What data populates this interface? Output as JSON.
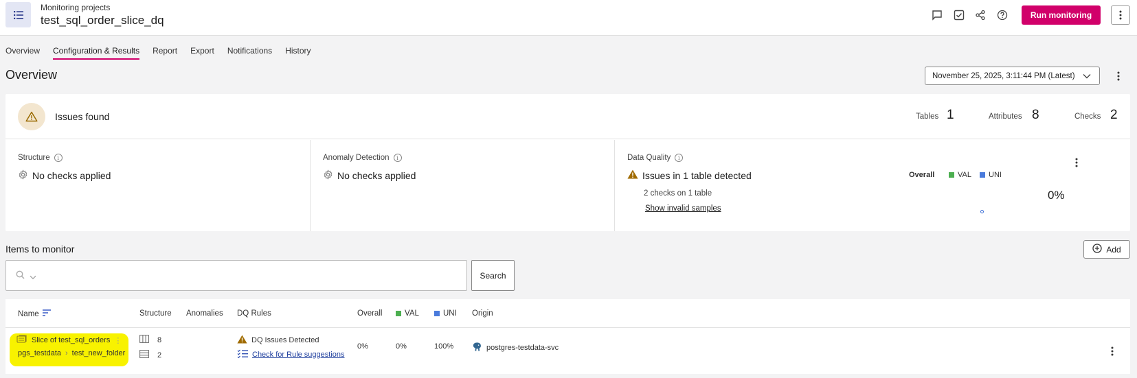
{
  "header": {
    "breadcrumb": "Monitoring projects",
    "title": "test_sql_order_slice_dq",
    "run_label": "Run monitoring",
    "icons": [
      "comment-icon",
      "task-check-icon",
      "share-icon",
      "help-icon",
      "more-vert-icon"
    ]
  },
  "tabs": [
    {
      "label": "Overview",
      "active": false
    },
    {
      "label": "Configuration & Results",
      "active": true
    },
    {
      "label": "Report",
      "active": false
    },
    {
      "label": "Export",
      "active": false
    },
    {
      "label": "Notifications",
      "active": false
    },
    {
      "label": "History",
      "active": false
    }
  ],
  "page": {
    "title": "Overview",
    "date_selected": "November 25, 2025, 3:11:44 PM (Latest)"
  },
  "summary": {
    "title": "Issues found",
    "tables_label": "Tables",
    "tables_value": "1",
    "attributes_label": "Attributes",
    "attributes_value": "8",
    "checks_label": "Checks",
    "checks_value": "2"
  },
  "panels": {
    "structure": {
      "label": "Structure",
      "status": "No checks applied"
    },
    "anomaly": {
      "label": "Anomaly Detection",
      "status": "No checks applied"
    },
    "dq": {
      "label": "Data Quality",
      "status": "Issues in 1 table detected",
      "sub": "2 checks on 1 table",
      "link": "Show invalid samples",
      "legend_overall": "Overall",
      "legend_val": "VAL",
      "legend_uni": "UNI",
      "overall_pct": "0%"
    }
  },
  "items": {
    "title": "Items to monitor",
    "add_label": "Add",
    "search_label": "Search",
    "search_value": ""
  },
  "table": {
    "headers": {
      "name": "Name",
      "structure": "Structure",
      "anomalies": "Anomalies",
      "dq_rules": "DQ Rules",
      "overall": "Overall",
      "val": "VAL",
      "uni": "UNI",
      "origin": "Origin"
    },
    "rows": [
      {
        "name": "Slice of test_sql_orders",
        "path_db": "pgs_testdata",
        "path_folder": "test_new_folder",
        "structure_attrs": "8",
        "structure_tables": "2",
        "dq_status": "DQ Issues Detected",
        "dq_link": "Check for Rule suggestions",
        "overall": "0%",
        "val": "0%",
        "uni": "100%",
        "origin": "postgres-testdata-svc"
      }
    ]
  },
  "colors": {
    "accent": "#d1006a",
    "val_green": "#4caf50",
    "uni_blue": "#4a7bdc",
    "warning": "#b07a00",
    "highlight": "#f8f200"
  }
}
